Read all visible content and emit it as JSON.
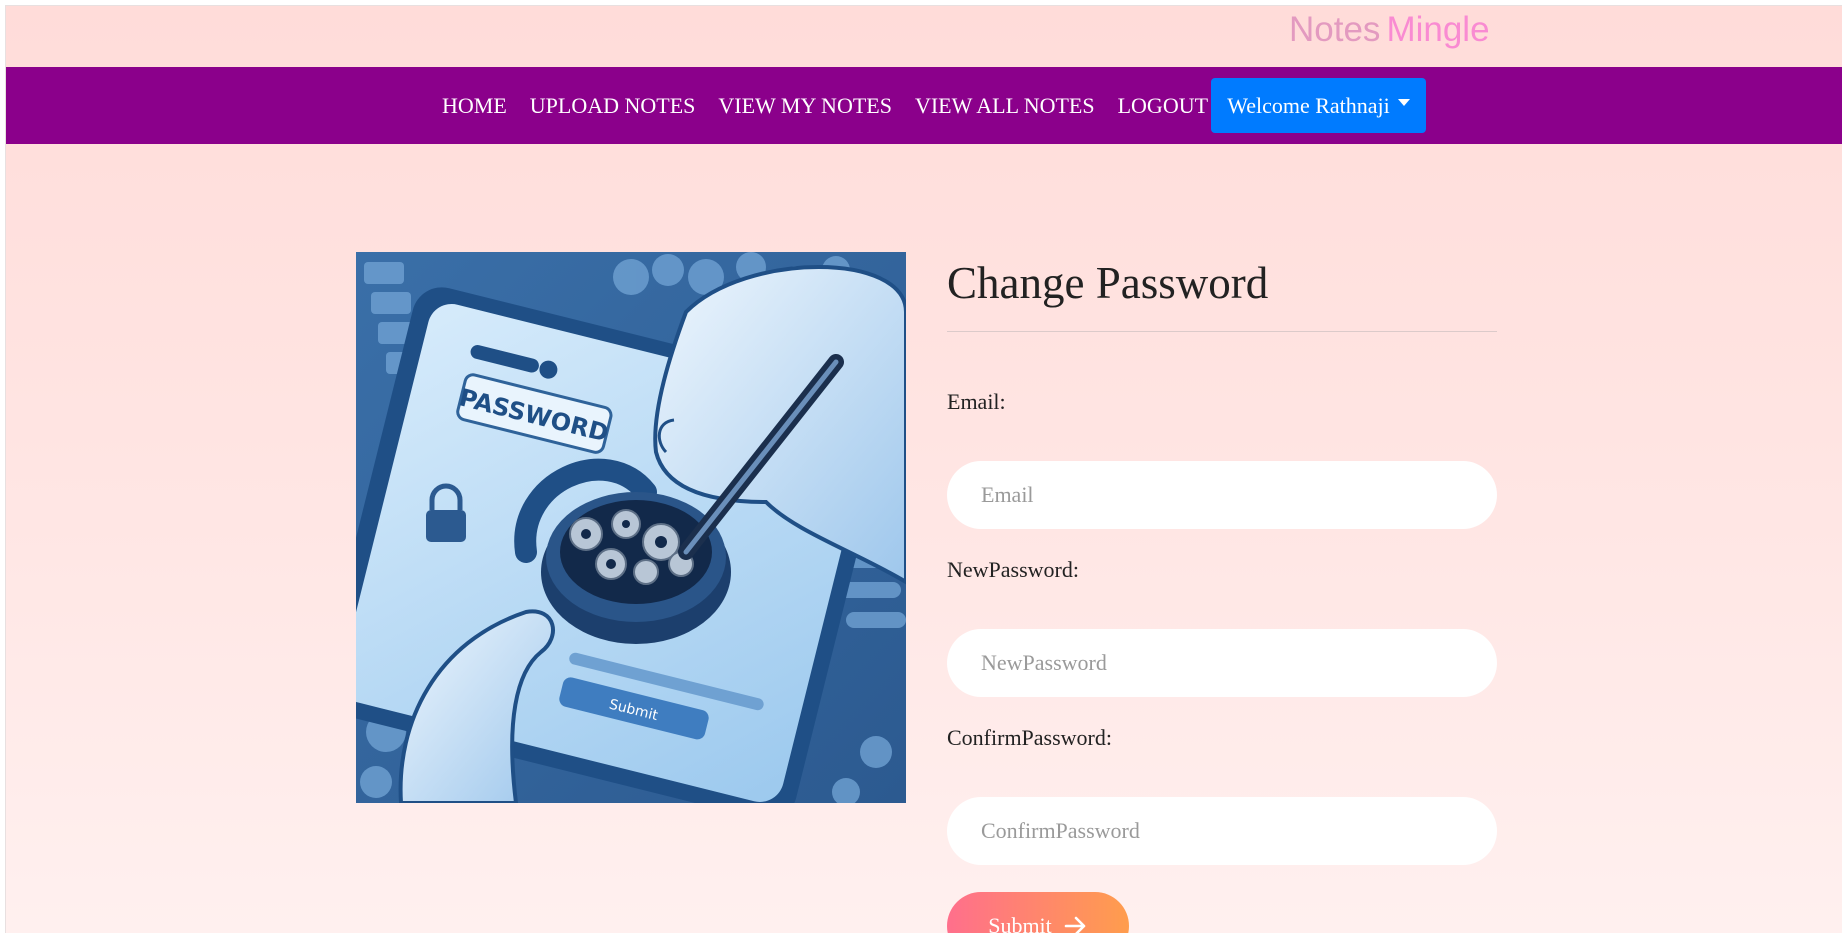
{
  "brand": {
    "part1": "Notes",
    "part2": "Mingle"
  },
  "nav": {
    "links": [
      "HOME",
      "UPLOAD NOTES",
      "VIEW MY NOTES",
      "VIEW ALL NOTES",
      "LOGOUT"
    ],
    "user_dropdown": "Welcome Rathnaji"
  },
  "hero_image": {
    "icon": "phone-padlock-illustration",
    "screen_text": "PASSWORD",
    "button_text": "Submit"
  },
  "form": {
    "title": "Change Password",
    "fields": [
      {
        "label": "Email:",
        "placeholder": "Email"
      },
      {
        "label": "NewPassword:",
        "placeholder": "NewPassword"
      },
      {
        "label": "ConfirmPassword:",
        "placeholder": "ConfirmPassword"
      }
    ],
    "submit_label": "Submit",
    "submit_icon": "arrow-right-icon"
  },
  "colors": {
    "navbar": "#8b008b",
    "dropdown": "#007bff",
    "brand_pink": "#f98bd2",
    "submit_gradient_start": "#ff6f8c",
    "submit_gradient_end": "#ff9d4d"
  }
}
